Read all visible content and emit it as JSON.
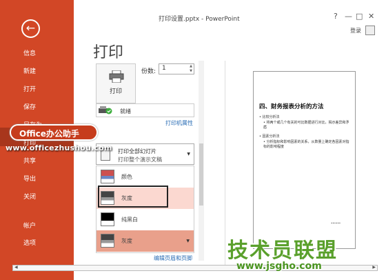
{
  "window": {
    "title": "打印设置.pptx - PowerPoint",
    "help": "?",
    "minimize": "—",
    "restore": "□",
    "close": "✕",
    "login": "登录"
  },
  "sidebar": {
    "back_icon": "←",
    "items": [
      {
        "label": "信息"
      },
      {
        "label": "新建"
      },
      {
        "label": "打开"
      },
      {
        "label": "保存"
      },
      {
        "label": "另存为"
      },
      {
        "label": "打印"
      },
      {
        "label": "共享"
      },
      {
        "label": "导出"
      },
      {
        "label": "关闭"
      },
      {
        "label": "帐户"
      },
      {
        "label": "选项"
      }
    ]
  },
  "main": {
    "page_title": "打印",
    "print_button": "打印",
    "copies_label": "份数:",
    "copies_value": "1",
    "printer_status": "就绪",
    "printer_properties": "打印机属性",
    "settings_line1": "打印全部幻灯片",
    "settings_line2": "打印整个演示文稿",
    "color_options": [
      {
        "label": "颜色"
      },
      {
        "label": "灰度"
      },
      {
        "label": "纯黑白"
      },
      {
        "label": "灰度"
      }
    ],
    "edit_header_footer": "编辑页眉和页脚"
  },
  "preview": {
    "slide_title": "四、财务报表分析的方法",
    "bullets": [
      "比较分析法",
      "将两个或几个有关的可比数据进行对比，揭示差异和矛盾",
      "因素分析法",
      "分析指标和影响因素的关系，从数量上确定各因素对指标的影响程度"
    ],
    "slide_number": "••••••"
  },
  "watermarks": {
    "office": "Office办公助手",
    "office_url": "www.officezhushou.com",
    "site": "技术员联盟",
    "site_url": "www.jsgho.com"
  },
  "colors": {
    "sidebar": "#d24726",
    "selected_option": "#e9a08b",
    "hover_option": "#fbd8d0",
    "link": "#2a6db5"
  },
  "icons": [
    "back-arrow-icon",
    "printer-icon",
    "printer-ready-icon",
    "slides-icon",
    "color-swatch-icon",
    "grayscale-swatch-icon",
    "blackwhite-swatch-icon",
    "chevron-down-icon"
  ]
}
